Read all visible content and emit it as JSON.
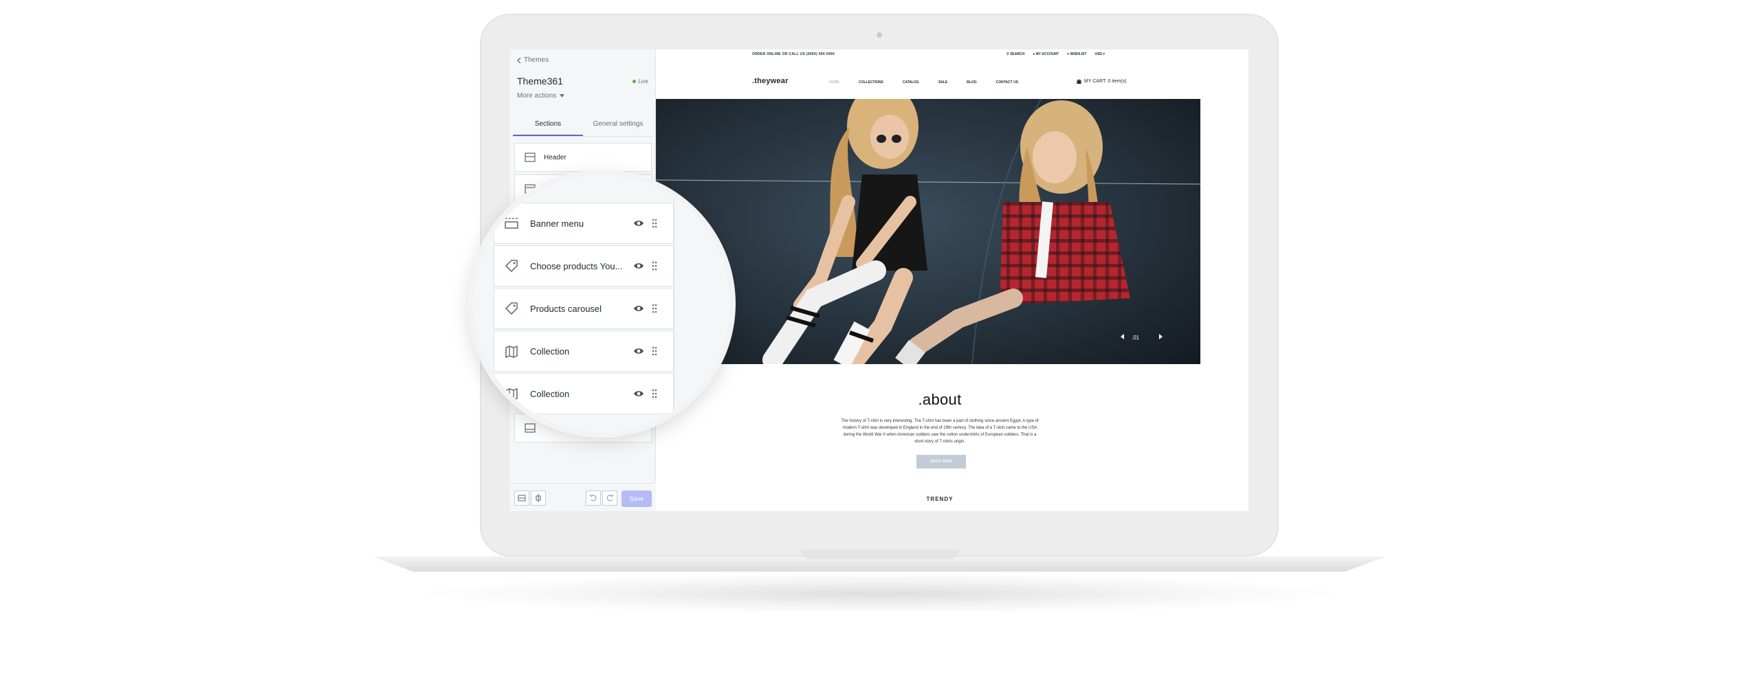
{
  "editor": {
    "back_label": "Themes",
    "theme_name": "Theme361",
    "status": "Live",
    "more_actions": "More actions",
    "tabs": [
      "Sections",
      "General settings"
    ],
    "sections": [
      {
        "label": "Header",
        "icon": "header-icon"
      },
      {
        "label": "",
        "icon": "section-icon"
      },
      {
        "label": "",
        "icon": "section-icon"
      }
    ],
    "save_label": "Save"
  },
  "magnifier": {
    "sections": [
      {
        "label": "Banner menu",
        "icon": "banner-menu-icon"
      },
      {
        "label": "Choose products You...",
        "icon": "tag-icon"
      },
      {
        "label": "Products carousel",
        "icon": "tag-icon"
      },
      {
        "label": "Collection",
        "icon": "collection-icon"
      },
      {
        "label": "Collection",
        "icon": "collection-icon"
      }
    ]
  },
  "store": {
    "order_text": "ORDER ONLINE OR CALL US (0000) 000 0000",
    "top_links": [
      "SEARCH",
      "MY ACCOUNT",
      "WISHLIST",
      "USD"
    ],
    "logo": ".theywear",
    "nav": [
      "HOME",
      "COLLECTIONS",
      "CATALOG",
      "SALE",
      "BLOG",
      "CONTACT US"
    ],
    "cart": "MY CART: 0 item(s)",
    "slider_index": ".01",
    "about_title": ".about",
    "about_text": "The history of T-shirt is very interesting. The T-shirt has been a part of clothing since ancient Egypt. A type of modern T-shirt was developed in England in the end of 19th century. The idea of a T-shirt came to the USA during the World War II when American soldiers saw the cotton undershirts of European soldiers. That is a short story of T-shirts origin.",
    "shop_button": "SHOP NOW",
    "trendy": "TRENDY"
  },
  "colors": {
    "accent": "#5c6ac4",
    "save_disabled": "#b3bcf5",
    "live_dot": "#50b83c"
  }
}
